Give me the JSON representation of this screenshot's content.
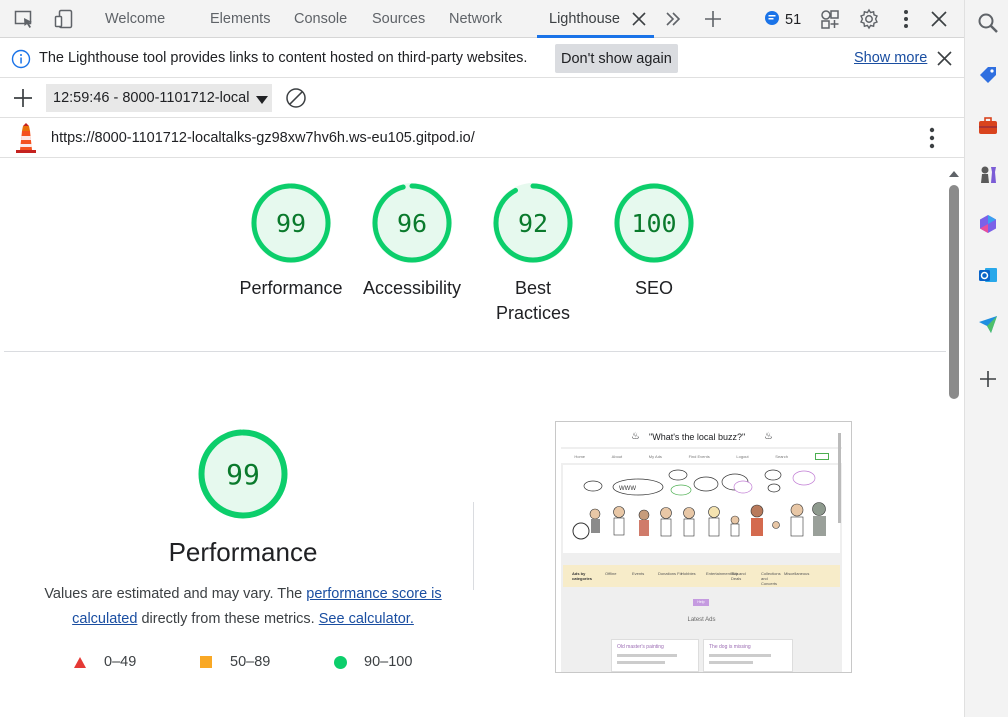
{
  "tabs": {
    "welcome": "Welcome",
    "elements": "Elements",
    "console": "Console",
    "sources": "Sources",
    "network": "Network",
    "lighthouse": "Lighthouse",
    "issues_count": "51"
  },
  "infobar": {
    "message": "The Lighthouse tool provides links to content hosted on third-party websites.",
    "dont_show": "Don't show again",
    "show_more": "Show more"
  },
  "toolbar": {
    "report_name": "12:59:46 - 8000-1101712-local"
  },
  "url": "https://8000-1101712-localtalks-gz98xw7hv6h.ws-eu105.gitpod.io/",
  "scores": [
    {
      "label": "Performance",
      "value": "99",
      "fraction": 0.99
    },
    {
      "label": "Accessibility",
      "value": "96",
      "fraction": 0.96
    },
    {
      "label": "Best Practices",
      "value": "92",
      "fraction": 0.92
    },
    {
      "label": "SEO",
      "value": "100",
      "fraction": 1.0
    }
  ],
  "performance": {
    "score": "99",
    "fraction": 0.99,
    "title": "Performance",
    "desc_1": "Values are estimated and may vary. The ",
    "link_score": "performance score is calculated",
    "desc_2": " directly from these metrics. ",
    "link_calc": "See calculator."
  },
  "legend": [
    {
      "range": "0–49",
      "color": "#e53935"
    },
    {
      "range": "50–89",
      "color": "#f9a825"
    },
    {
      "range": "90–100",
      "color": "#0cce6b"
    }
  ],
  "thumbnail": {
    "site_title": "\"What's the local buzz?\"",
    "nav": [
      "Home",
      "About",
      "My Ads",
      "Find Events",
      "Logout",
      "Search"
    ],
    "cat_label": "Ads by categories",
    "categories": [
      "Offline",
      "Events",
      "Donations Fix",
      "Hobbies",
      "Entertainment Bits",
      "Buy and Deals",
      "Collections and Concerts",
      "Miscellaneous"
    ],
    "badge": "Help",
    "latest_ads": "Latest Ads",
    "ad1": "Old master's painting",
    "ad2": "The dog is missing",
    "speech": "WWW"
  },
  "colors": {
    "pass_green": "#0cce6b",
    "pass_fill": "#e6f9ee",
    "pass_text": "#0a7a2c",
    "accent_blue": "#1a73e8"
  }
}
